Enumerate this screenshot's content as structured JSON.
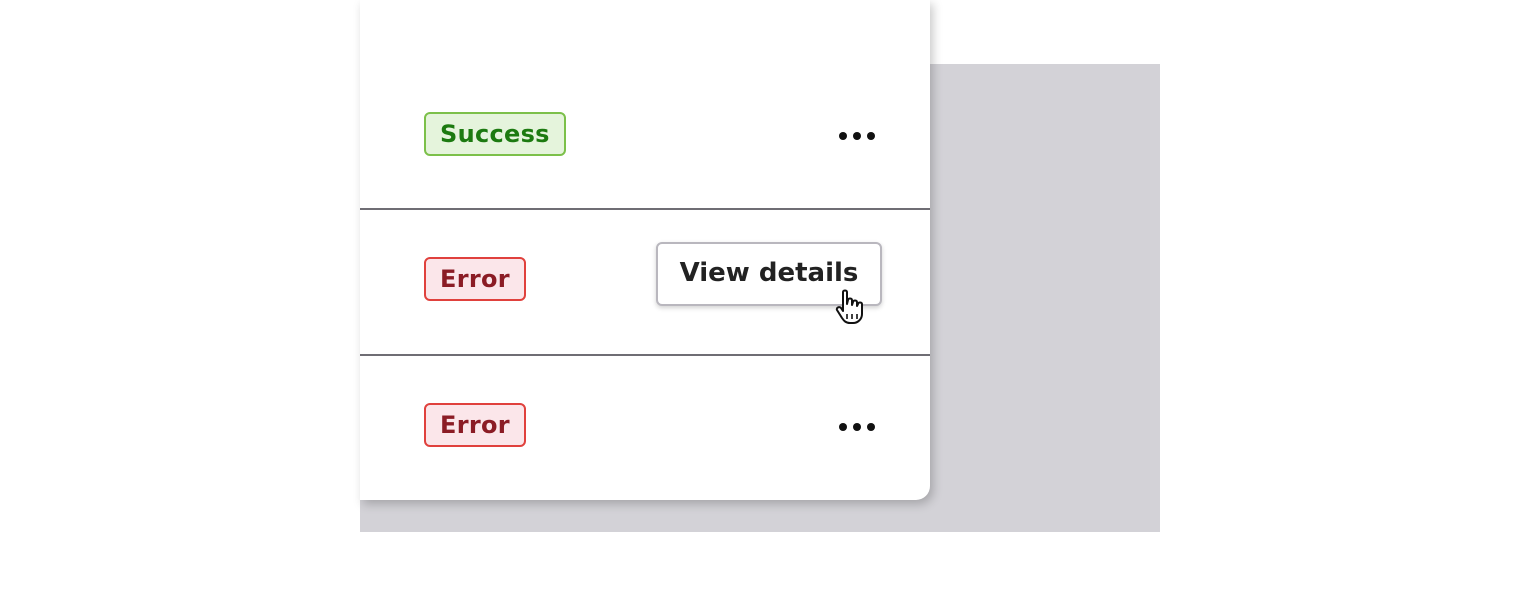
{
  "rows": [
    {
      "status": "Success",
      "status_kind": "success",
      "actions_icon": "ellipsis-icon"
    },
    {
      "status": "Error",
      "status_kind": "error",
      "actions_icon": "ellipsis-icon"
    },
    {
      "status": "Error",
      "status_kind": "error",
      "actions_icon": "ellipsis-icon"
    }
  ],
  "menu": {
    "items": [
      {
        "label": "View details"
      }
    ]
  },
  "cursor": "pointer-hand-icon",
  "colors": {
    "success_text": "#1c7a10",
    "success_bg": "#e5f4dc",
    "success_border": "#7cc04a",
    "error_text": "#8b1c25",
    "error_bg": "#fbe6ea",
    "error_border": "#e0413d",
    "backdrop": "#d3d2d7"
  }
}
